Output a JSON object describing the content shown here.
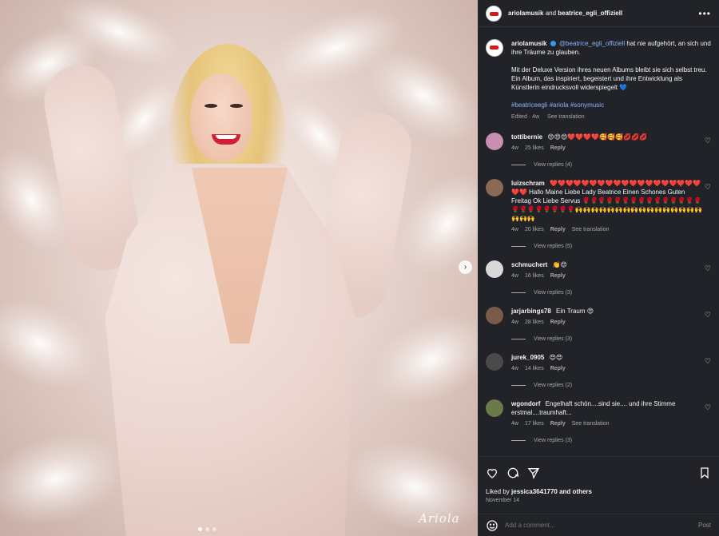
{
  "header": {
    "account1": "ariolamusik",
    "joiner": " and ",
    "account2": "beatrice_egli_offiziell",
    "more_icon": "more-horizontal-icon"
  },
  "caption": {
    "user": "ariolamusik",
    "mention": "@beatrice_egli_offiziell",
    "text1": " hat nie aufgehört, an sich und ihre Träume zu glauben.",
    "text2": "Mit der Deluxe Version ihres neuen Albums bleibt sie sich selbst treu. Ein Album, das inspiriert, begeistert und ihre Entwicklung als Künstlerin eindrucksvoll widerspiegelt 💙",
    "hashtags": "#beatriceegli #ariola #sonymusic",
    "edited": "Edited · 4w",
    "see_translation": "See translation"
  },
  "comments": [
    {
      "user": "tottibernie",
      "text": "😍😍😍❤️❤️❤️❤️🥰🥰🥰💋💋💋",
      "time": "4w",
      "likes": "25 likes",
      "reply": "Reply",
      "translation": "",
      "view_replies": "View replies (4)",
      "avatar_color": "#c98fb0"
    },
    {
      "user": "luizschram",
      "text": "❤️❤️❤️❤️❤️❤️❤️❤️❤️❤️❤️❤️❤️❤️❤️❤️❤️❤️❤️❤️❤️ Hallo Maine Liebe Lady Beatrice Einen Schones Guten Freitag Ok Liebe Servus 🌹🌹🌹🌹🌹🌹🌹🌹🌹🌹🌹🌹🌹🌹🌹🌹🌹🌹🌹🌹🌹🌹🌹🙌🙌🙌🙌🙌🙌🙌🙌🙌🙌🙌🙌🙌🙌🙌🙌🙌🙌🙌",
      "time": "4w",
      "likes": "20 likes",
      "reply": "Reply",
      "translation": "See translation",
      "view_replies": "View replies (5)",
      "avatar_color": "#8a6a52"
    },
    {
      "user": "schmuchert",
      "text": "👏😍",
      "time": "4w",
      "likes": "16 likes",
      "reply": "Reply",
      "translation": "",
      "view_replies": "View replies (3)",
      "avatar_color": "#d8d8d8"
    },
    {
      "user": "jarjarbings78",
      "text": "Ein Traum 😍",
      "time": "4w",
      "likes": "28 likes",
      "reply": "Reply",
      "translation": "",
      "view_replies": "View replies (3)",
      "avatar_color": "#7a5a4a"
    },
    {
      "user": "jurek_0905",
      "text": "😍😍",
      "time": "4w",
      "likes": "14 likes",
      "reply": "Reply",
      "translation": "",
      "view_replies": "View replies (2)",
      "avatar_color": "#4a4a4a"
    },
    {
      "user": "wgondorf",
      "text": "Engelhaft schön....sind sie.... und ihre Stimme erstmal....traumhaft...",
      "time": "4w",
      "likes": "17 likes",
      "reply": "Reply",
      "translation": "See translation",
      "view_replies": "View replies (3)",
      "avatar_color": "#6a7a4a"
    }
  ],
  "actions": {
    "like_icon": "heart-icon",
    "comment_icon": "comment-icon",
    "share_icon": "share-icon",
    "save_icon": "bookmark-icon",
    "liked_by_prefix": "Liked by ",
    "liked_by_user": "jessica3641770",
    "liked_by_suffix": " and others",
    "date": "November 14"
  },
  "add_comment": {
    "placeholder": "Add a comment...",
    "post": "Post",
    "emoji_icon": "emoji-icon"
  },
  "media": {
    "watermark": "Ariola",
    "next_icon": "chevron-right-icon",
    "slide_count": 3,
    "active_slide": 1
  }
}
